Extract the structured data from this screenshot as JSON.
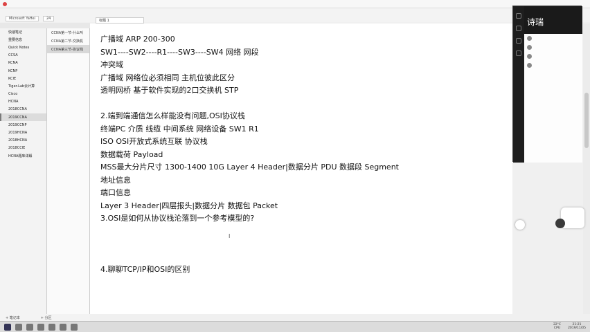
{
  "note_lines": [
    "广播域  ARP 200-300",
    "SW1----SW2----R1----SW3----SW4 网络 网段",
    "冲突域",
    "广播域 网络位必须相同  主机位彼此区分",
    "透明网桥 基于软件实现的2口交换机  STP",
    "",
    "2.端到端通信怎么样能没有问题,OSI协议栈",
    "终端PC  介质 线缆  中间系统 网络设备  SW1 R1",
    "ISO OSI开放式系统互联 协议栈",
    "数据载荷  Payload",
    "MSS最大分片尺寸 1300-1400  10G  Layer 4 Header|数据分片 PDU 数据段 Segment",
    "地址信息",
    "端口信息",
    "Layer 3 Header|四层报头|数据分片 数据包 Packet",
    "3.OSI是如何从协议栈沦落到一个参考模型的?",
    "",
    "",
    "",
    "4.聊聊TCP/IP和OSI的区别"
  ],
  "notebooks": [
    "快速笔记",
    "重要信息",
    "Quick Notes",
    "CCSA",
    "KCNA",
    "KCNP",
    "KCIE",
    "Tiger-Lab云计算",
    "Cisco",
    "HCNA",
    "2018CCNA",
    "2019CCNA",
    "2019CCNP",
    "2019HCNA",
    "2018HCNA",
    "2018CCIE",
    "HCNA题库详解"
  ],
  "active_notebook_index": 11,
  "sections": [
    "CCNA第一节-什么叫",
    "CCNA第二节-交换机",
    "CCNA第三节-协议栈"
  ],
  "active_section_index": 2,
  "page_tab": "标题 1",
  "ribbon": {
    "font": "Microsoft YaHei",
    "size": "24"
  },
  "sidebar_footer": {
    "add_notebook": "+ 笔记本",
    "add_section": "+ 分区"
  },
  "chat": {
    "title": "诗瑞"
  },
  "taskbar": {
    "temp": "22°C",
    "cpu": "CPU",
    "time": "21:21",
    "date": "2019/11/05"
  },
  "colors": {
    "accent": "#7a7a7a",
    "canvas": "#ffffff"
  }
}
